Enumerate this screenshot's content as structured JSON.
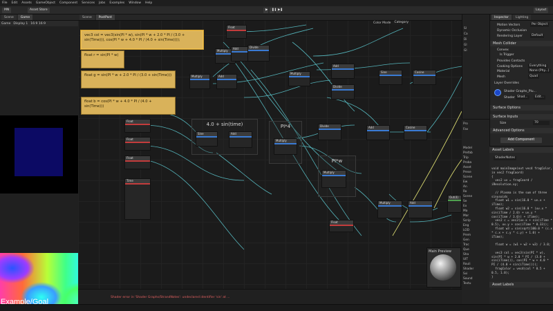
{
  "menubar": [
    "File",
    "Edit",
    "Assets",
    "GameObject",
    "Component",
    "Services",
    "Jobs",
    "Examples",
    "Window",
    "Help"
  ],
  "toolbar": {
    "account": "MN",
    "asset_store": "Asset Store",
    "layout": "Layout"
  },
  "left_tabs": [
    "Scene",
    "Game"
  ],
  "left_sub": {
    "display": "Game",
    "display_num": "Display 1",
    "aspect": "16:9 16:9"
  },
  "graph_tabs": [
    "Scene",
    "PostPant"
  ],
  "graph_toolbar": {
    "color_mode": "Color Mode",
    "category": "Category"
  },
  "stickies": [
    {
      "text": "vec3 col = vec3(sin(PI * w), sin(PI * w + 2.0 * PI / (3.0 + sin(Time))), cos(PI * w + 4.0 * PI / (4.0 + sin(Time))));"
    },
    {
      "text": "float r = sin(PI * w)"
    },
    {
      "text": "float g = sin(PI * w + 2.0 * PI / (3.0 + sin(Time)))"
    },
    {
      "text": "float b = cos(PI * w + 4.0 * PI / (4.0 + sin(Time)))"
    }
  ],
  "groups": [
    {
      "title": "4.0 + sin(time)"
    },
    {
      "title": "PI*4"
    },
    {
      "title": "PI*w"
    }
  ],
  "nodes": {
    "float_labels": [
      "Float",
      "Float",
      "Float",
      "Time",
      "Float",
      "Multiply",
      "Add",
      "Divide",
      "Sine",
      "Cosine"
    ],
    "combine_out": "Out(4)"
  },
  "main_preview": "Main Preview",
  "console_msg": "Shader error in 'Shader Graphs/StrandNotes': undeclared identifier 'sin' at ...",
  "goal_caption": "Example/Goal",
  "inspector": {
    "tabs": [
      "Inspector",
      "Lighting"
    ],
    "motion_vectors": "Motion Vectors",
    "motion_value": "Per Object",
    "dynamic_occlusion": "Dynamic Occlusion",
    "rendering_layer": "Rendering Layer",
    "rendering_value": "Default",
    "mesh_collider": "Mesh Collider",
    "convex": "Convex",
    "is_trigger": "Is Trigger",
    "provides_contacts": "Provides Contacts",
    "cooking_options": "Cooking Options",
    "cooking_value": "Everything",
    "material": "Material",
    "material_value": "None (Phy...)",
    "mesh": "Mesh",
    "mesh_value": "Quad",
    "layer_overrides": "Layer Overrides",
    "shader_graph": "Shader Graphs_Plu...",
    "shader": "Shader",
    "shader_value": "Shad...",
    "edit": "Edit...",
    "surface_options": "Surface Options",
    "surface_inputs": "Surface Inputs",
    "size_label": "Size",
    "size_value": "70",
    "advanced": "Advanced Options",
    "add_component": "Add Component"
  },
  "asset_labels": {
    "title": "Asset Labels",
    "file": "ShaderNotes",
    "code": "void mainImage(out vec4 fragColor, in vec2 fragCoord)\n{\n  vec2 uv = fragCoord / iResolution.xy;\n\n  // Plasma is the sum of three sinusoids\n  float w1 = sin(16.0 * uv.x + iTime);\n  float w2 = sin(16.0 * (uv.x * sin(iTime / 2.0) + uv.y * cos(iTime / 3.0)) + iTime);\n  vec2 c = vec2(uv.x + sin(iTime * 0.5), uv.y + cos(iTime * 0.33));\n  float w3 = sin(sqrt(100.0 * (c.x * c.x + c.y * c.y) + 1.0) + iTime);\n\n  float w = (w1 + w2 + w3) / 3.0;\n\n  vec3 col = vec3(sin(PI * w), sin(PI * w + 2.0 * PI / (3.0 + sin(iTime))), cos(PI * w + 4.0 * PI / (4.0 + sin(iTime))));\n  fragColor = vec4(col * 0.5 + 0.5, 1.0);\n}",
    "footer": "Asset Labels"
  },
  "hierarchy": [
    "Sl",
    "Ca",
    "Di",
    "Gl",
    "Gl"
  ],
  "project_tree": [
    "Pro",
    "Fav",
    "Model",
    "Prefab",
    "Trip",
    "Proba",
    "Asset",
    "Prese",
    "Scene",
    "Ew",
    "An",
    "Ro",
    "Scene",
    "Se",
    "Ex",
    "Ma",
    "Mar",
    "Scrip",
    "Eng",
    "LOD",
    "Prem",
    "Gen",
    "Trac",
    "Que",
    "Sha",
    "UIT",
    "Rouli",
    "Shader",
    "Svi",
    "Sound",
    "Textu"
  ]
}
